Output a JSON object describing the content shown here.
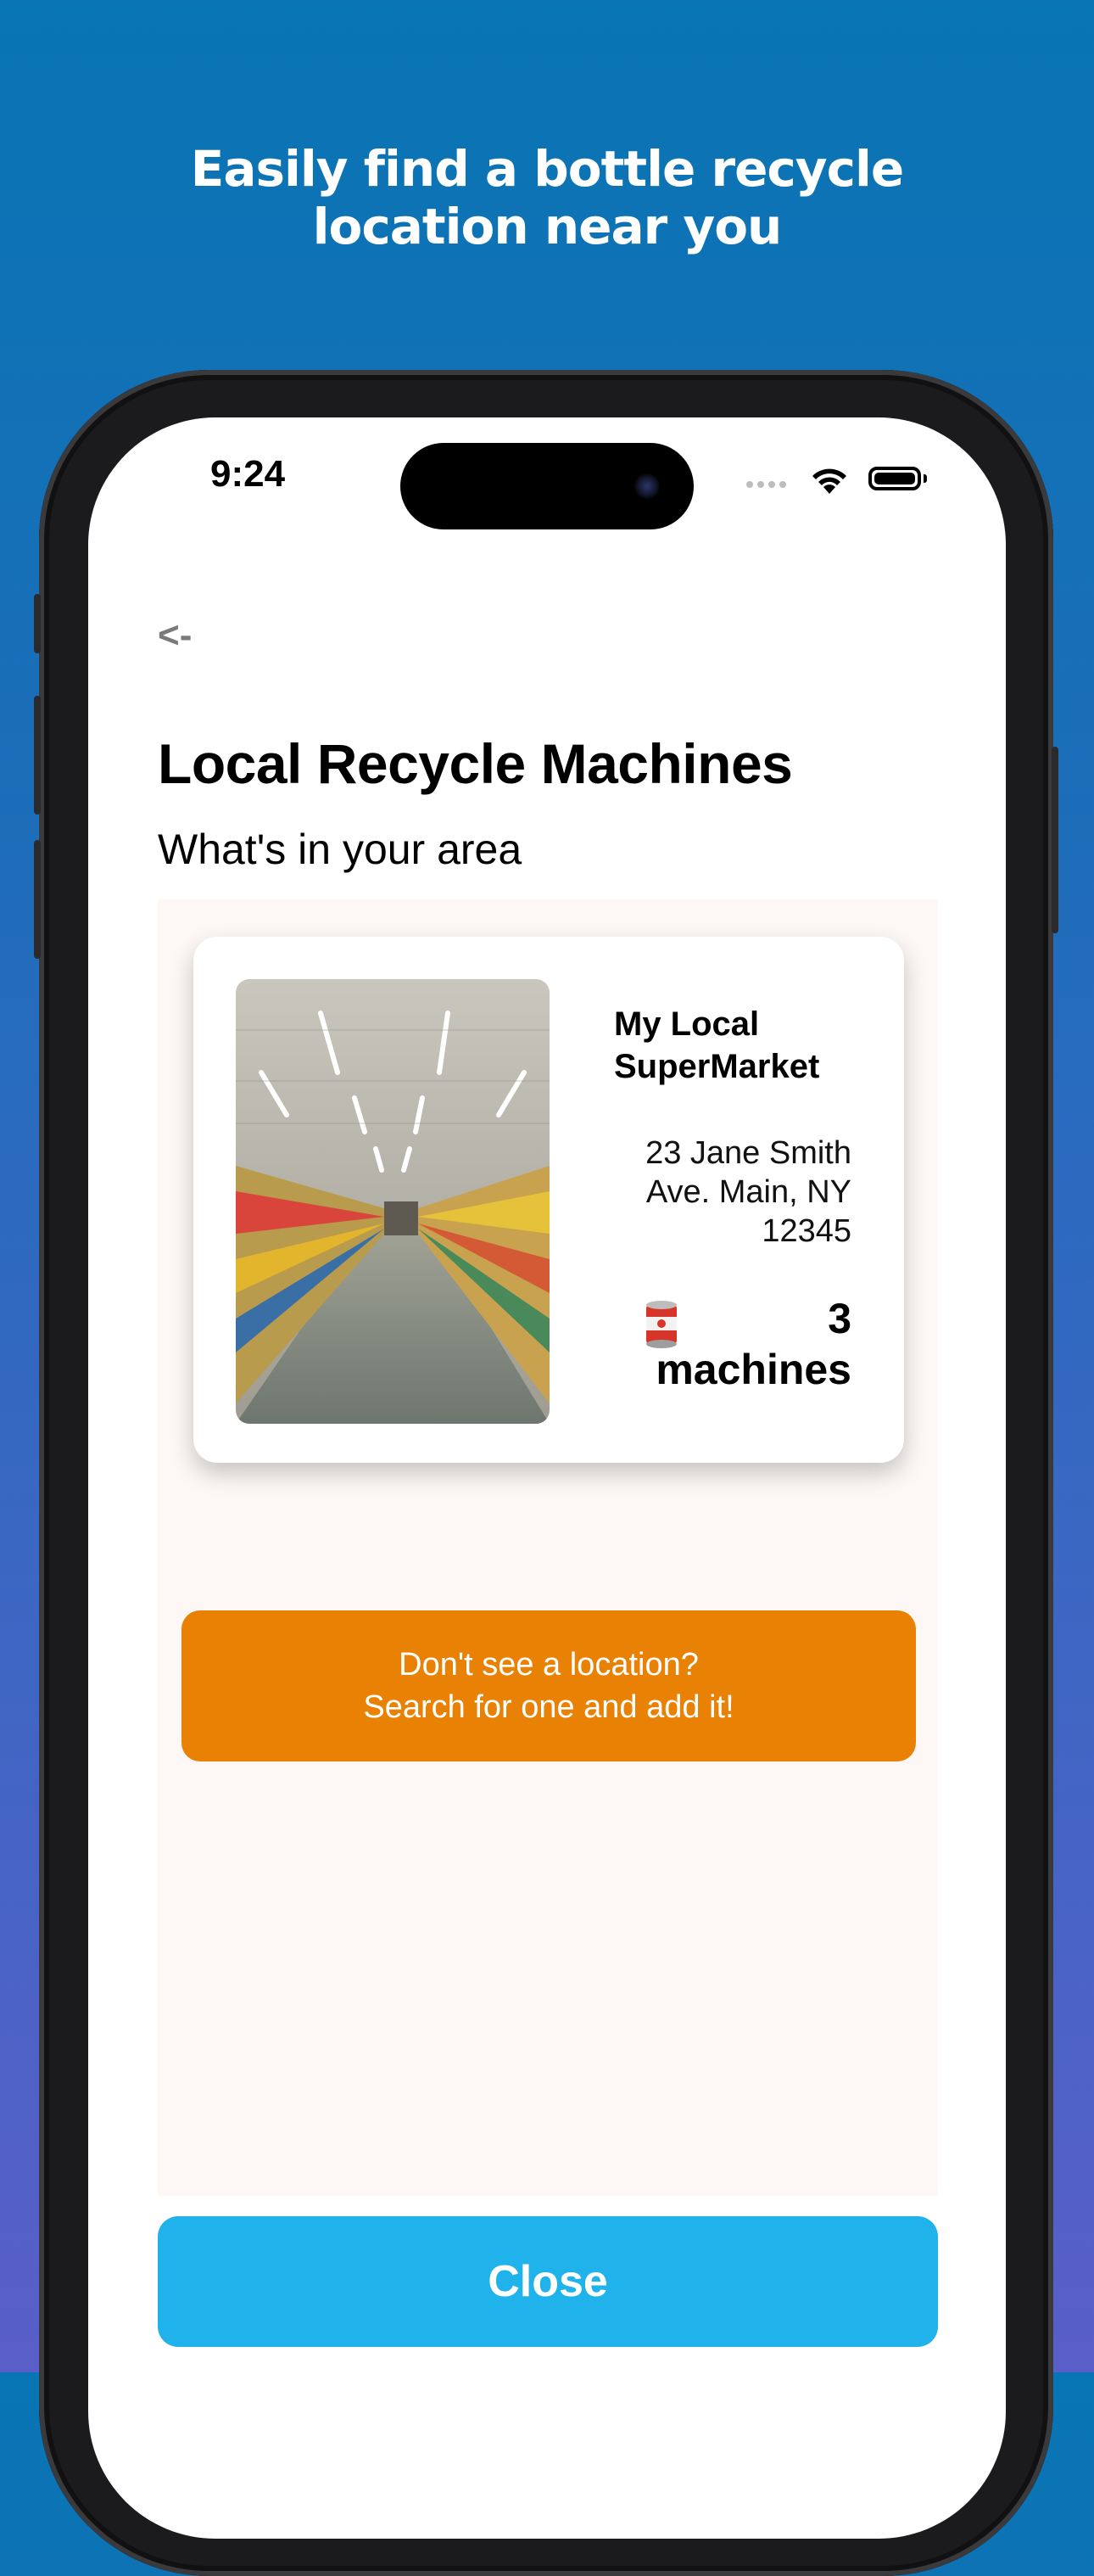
{
  "promo": {
    "headline_line1": "Easily find a bottle recycle",
    "headline_line2": "location near you"
  },
  "status_bar": {
    "time": "9:24",
    "icons": [
      "cellular-signal-icon",
      "wifi-icon",
      "battery-icon"
    ]
  },
  "screen": {
    "back_label": "<-",
    "title": "Local Recycle Machines",
    "subtitle": "What's in your area"
  },
  "locations": [
    {
      "name": "My Local SuperMarket",
      "address_line1": "23 Jane Smith",
      "address_line2": "Ave. Main, NY",
      "address_line3": "12345",
      "machine_icon": "🥫",
      "machine_count": "3",
      "machine_unit": "machines"
    }
  ],
  "add_location_button": {
    "line1": "Don't see a location?",
    "line2": "Search for one and add it!"
  },
  "close_button": {
    "label": "Close"
  },
  "colors": {
    "background_top": "#0875b4",
    "background_bottom": "#5a5ec9",
    "add_button": "#e98204",
    "close_button": "#20b2ea",
    "content_area": "#fdf8f5"
  }
}
